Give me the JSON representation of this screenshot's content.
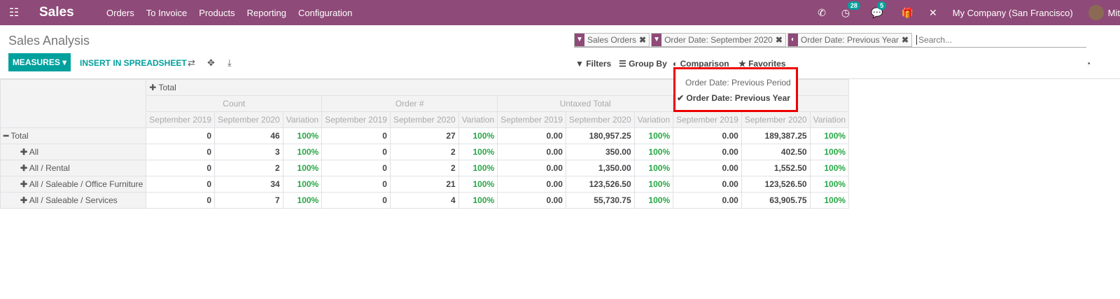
{
  "nav": {
    "app": "Sales",
    "menu": [
      "Orders",
      "To Invoice",
      "Products",
      "Reporting",
      "Configuration"
    ],
    "activity_count": "28",
    "message_count": "5",
    "company": "My Company (San Francisco)",
    "user": "Mit"
  },
  "page": {
    "title": "Sales Analysis",
    "measures": "MEASURES",
    "insert": "INSERT IN SPREADSHEET"
  },
  "search": {
    "facets": [
      "Sales Orders",
      "Order Date: September 2020",
      "Order Date: Previous Year"
    ],
    "placeholder": "Search..."
  },
  "filters": {
    "filters": "Filters",
    "group_by": "Group By",
    "comparison": "Comparison",
    "favorites": "Favorites"
  },
  "comparison_menu": {
    "items": [
      "Order Date: Previous Period",
      "Order Date: Previous Year"
    ],
    "selected": "Order Date: Previous Year"
  },
  "pivot": {
    "col_header": "Total",
    "measures": [
      "Count",
      "Order #",
      "Untaxed Total",
      ""
    ],
    "subcols": [
      "September 2019",
      "September 2020",
      "Variation"
    ],
    "rows": [
      {
        "label": "Total",
        "cells": [
          "0",
          "46",
          "100%",
          "0",
          "27",
          "100%",
          "0.00",
          "180,957.25",
          "100%",
          "0.00",
          "189,387.25",
          "100%"
        ]
      },
      {
        "label": "All",
        "cells": [
          "0",
          "3",
          "100%",
          "0",
          "2",
          "100%",
          "0.00",
          "350.00",
          "100%",
          "0.00",
          "402.50",
          "100%"
        ]
      },
      {
        "label": "All / Rental",
        "cells": [
          "0",
          "2",
          "100%",
          "0",
          "2",
          "100%",
          "0.00",
          "1,350.00",
          "100%",
          "0.00",
          "1,552.50",
          "100%"
        ]
      },
      {
        "label": "All / Saleable / Office Furniture",
        "cells": [
          "0",
          "34",
          "100%",
          "0",
          "21",
          "100%",
          "0.00",
          "123,526.50",
          "100%",
          "0.00",
          "123,526.50",
          "100%"
        ]
      },
      {
        "label": "All / Saleable / Services",
        "cells": [
          "0",
          "7",
          "100%",
          "0",
          "4",
          "100%",
          "0.00",
          "55,730.75",
          "100%",
          "0.00",
          "63,905.75",
          "100%"
        ]
      }
    ]
  },
  "colors": {
    "brand": "#8e4a78",
    "accent": "#00a09d",
    "positive": "#28a745",
    "highlight": "#ee0000"
  }
}
